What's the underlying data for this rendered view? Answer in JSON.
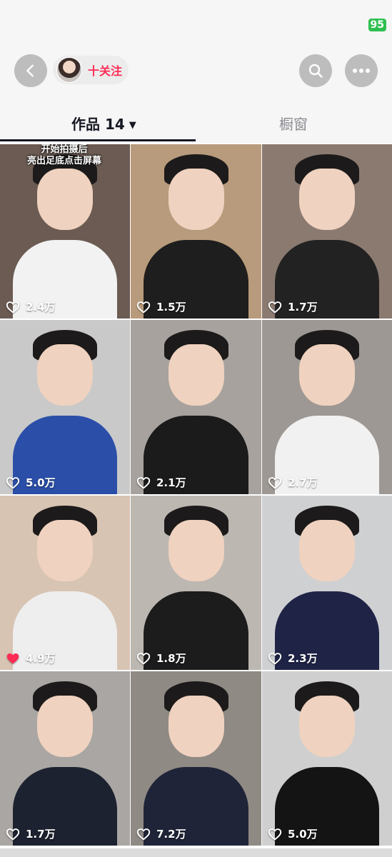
{
  "status_bar": {
    "battery": "95"
  },
  "header": {
    "back_icon": "chevron-left-icon",
    "follow_label": "十关注",
    "search_icon": "search-icon",
    "more_icon": "more-horizontal-icon"
  },
  "tabs": {
    "works_label": "作品 14",
    "works_caret": "▼",
    "window_label": "橱窗"
  },
  "videos": [
    {
      "likes": "2.4万",
      "liked": false,
      "overlay": "开始拍摄后\n亮出足底点击屏幕",
      "bg": "#6b5b52",
      "shirt": "#f2f2f2"
    },
    {
      "likes": "1.5万",
      "liked": false,
      "bg": "#b89b7c",
      "shirt": "#1e1e1e"
    },
    {
      "likes": "1.7万",
      "liked": false,
      "bg": "#8b7a70",
      "shirt": "#222222"
    },
    {
      "likes": "5.0万",
      "liked": false,
      "bg": "#c9c9c9",
      "shirt": "#2b4fa8"
    },
    {
      "likes": "2.1万",
      "liked": false,
      "bg": "#a7a29e",
      "shirt": "#1b1b1b"
    },
    {
      "likes": "2.7万",
      "liked": false,
      "bg": "#9d9893",
      "shirt": "#f1f1f1"
    },
    {
      "likes": "4.9万",
      "liked": true,
      "bg": "#d8c4b3",
      "shirt": "#eeeeee"
    },
    {
      "likes": "1.8万",
      "liked": false,
      "bg": "#bdb7b2",
      "shirt": "#1c1c1c"
    },
    {
      "likes": "2.3万",
      "liked": false,
      "bg": "#cfd0d2",
      "shirt": "#1f2447"
    },
    {
      "likes": "1.7万",
      "liked": false,
      "bg": "#a9a6a3",
      "shirt": "#1d2230"
    },
    {
      "likes": "7.2万",
      "liked": false,
      "bg": "#8f8a83",
      "shirt": "#1f2438"
    },
    {
      "likes": "5.0万",
      "liked": false,
      "bg": "#cfcfcf",
      "shirt": "#141414"
    }
  ],
  "colors": {
    "accent": "#fe2c55",
    "battery": "#2ebf4f"
  }
}
